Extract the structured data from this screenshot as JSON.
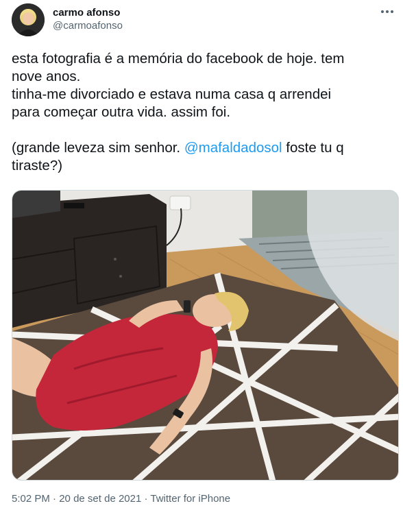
{
  "tweet": {
    "display_name": "carmo afonso",
    "handle": "@carmoafonso",
    "line1": "esta fotografia é a memória do facebook de hoje. tem",
    "line2": "nove anos.",
    "line3": "tinha-me divorciado e estava numa casa q arrendei",
    "line4": "para começar outra vida. assim foi.",
    "line5_pre": "(grande leveza sim senhor. ",
    "mention": "@mafaldadosol",
    "line5_post": " foste tu q",
    "line6": "tiraste?)",
    "time": "5:02 PM",
    "separator1": " · ",
    "date": "20 de set de 2021",
    "separator2": " · ",
    "source": "Twitter for iPhone"
  },
  "icons": {
    "more": "more-horizontal-icon"
  },
  "colors": {
    "link": "#1d9bf0",
    "secondary_text": "#536471",
    "primary_text": "#0f1419",
    "dress": "#c4263a",
    "rug": "#5a4a3e",
    "floor": "#c99a5c"
  }
}
